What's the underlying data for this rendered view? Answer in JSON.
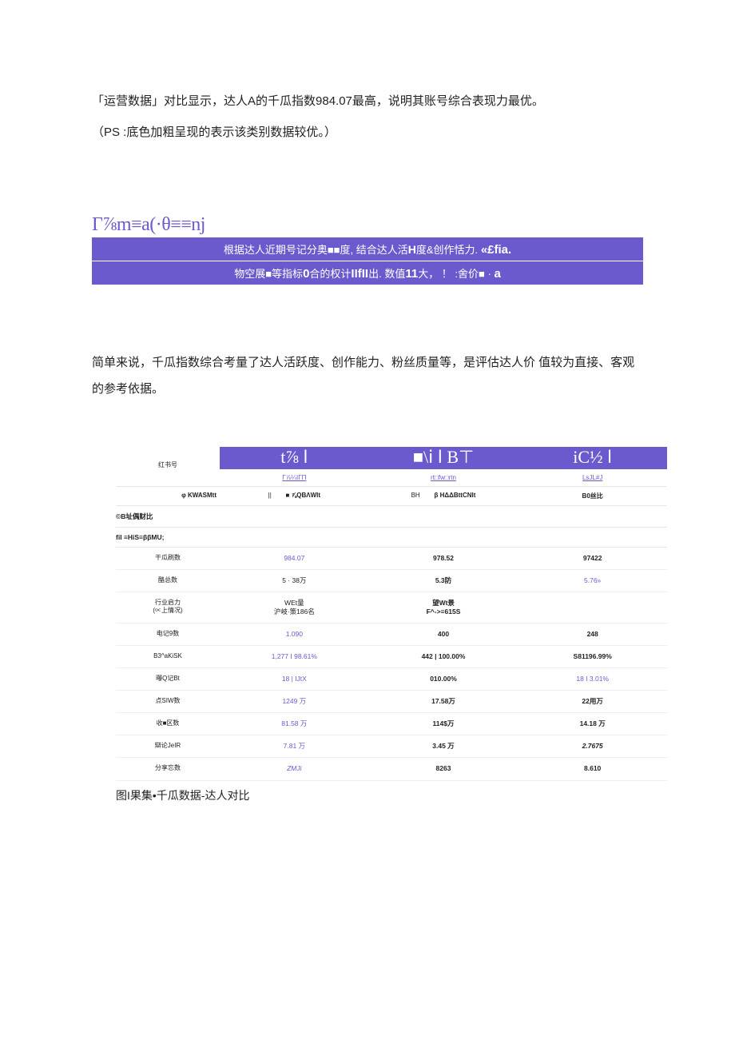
{
  "intro": {
    "line1": "「运营数据」对比显示，达人A的千瓜指数984.07最高，说明其账号综合表现力最优。",
    "line2": "（PS :底色加粗呈现的表示该类别数据较优。）"
  },
  "formula_heading": "Γ⅞m≡a(·θ≡≡nj",
  "banner": {
    "row1_a": "根据达人近期号记分奥■■度, 结合达人活",
    "row1_b": "H",
    "row1_c": "度&创作恬力.",
    "row1_d": "«£fia.",
    "row2_a": "物空展■等指标",
    "row2_b": "0",
    "row2_c": "合的权计",
    "row2_d": "IIfII",
    "row2_e": "出. 数值",
    "row2_f": "11",
    "row2_g": "大， ！ :舍价■ ·",
    "row2_h": "a"
  },
  "middle_para": "简单来说，千瓜指数综合考量了达人活跃度、创作能力、粉丝质量等，是评估达人价 值较为直接、客观的参考依据。",
  "table": {
    "header_label": "红书号",
    "headers": [
      "t⅞ ⅼ",
      "■\\ⅰ ⅼ B⊤",
      "iC½ ⅼ"
    ],
    "ids": [
      "Γ⅞¼ⅼΓΠ",
      "rt□fw□rtn",
      "LsJL#J"
    ],
    "compare_row": {
      "label": "φ KWASMtt",
      "c1a": "||",
      "c1b": "■ ⅞QBΛWIt",
      "c2a": "BH",
      "c2b": "β HΔΔBttCNIt",
      "c3": "B0丝比"
    },
    "section1": "©B址偶财比",
    "section2": "fiI ≡HiS≡ββMU;",
    "rows": [
      {
        "label": "干瓜刷数",
        "a": "984.07",
        "b": "978.52",
        "c": "97422",
        "a_purp": true,
        "b_bold": true,
        "c_bold": true
      },
      {
        "label": "酪总数",
        "a": "5 · 38万",
        "b": "5.3防",
        "c": "5.76»",
        "b_bold": true,
        "c_purp": true
      },
      {
        "label": "行业启力\n(∝上情况)",
        "a": "WEt量\n沪岐·策186名",
        "b": "望Wt景\nF^->≡615S",
        "c": "",
        "b_bold": true
      },
      {
        "label": "电记9数",
        "a": "1.090",
        "b": "400",
        "c": "248",
        "a_purp": true,
        "b_bold": true,
        "c_bold": true
      },
      {
        "label": "B3^aKiSK",
        "a": "1,277 I 98.61%",
        "b": "442 | 100.00%",
        "c": "S81196.99%",
        "a_purp": true,
        "b_bold": true,
        "c_bold": true
      },
      {
        "label": "曝Q记Bt",
        "a": "18 | IJtX",
        "b": "010.00%",
        "c": "18 I 3.01%",
        "a_purp": true,
        "b_bold": true,
        "c_purp": true
      },
      {
        "label": "点SIW数",
        "a": "1249 万",
        "b": "17.58万",
        "c": "22用万",
        "a_purp": true,
        "b_bold": true,
        "c_bold": true
      },
      {
        "label": "收■区数",
        "a": "81.58 万",
        "b": "114$万",
        "c": "14.18 万",
        "a_purp": true,
        "b_bold": true,
        "c_bold": true
      },
      {
        "label": "辯论JeIR",
        "a": "7.81 万",
        "b": "3.45 万",
        "c": "2.7675",
        "a_purp": true,
        "b_bold": true,
        "c_ital": true,
        "c_bold": true
      },
      {
        "label": "分享忘数",
        "a": "ZMJi",
        "b": "8263",
        "c": "8.610",
        "a_purp": true,
        "a_ital": true,
        "b_bold": true,
        "c_bold": true
      }
    ]
  },
  "caption": "图I果集•千瓜数据-达人对比"
}
